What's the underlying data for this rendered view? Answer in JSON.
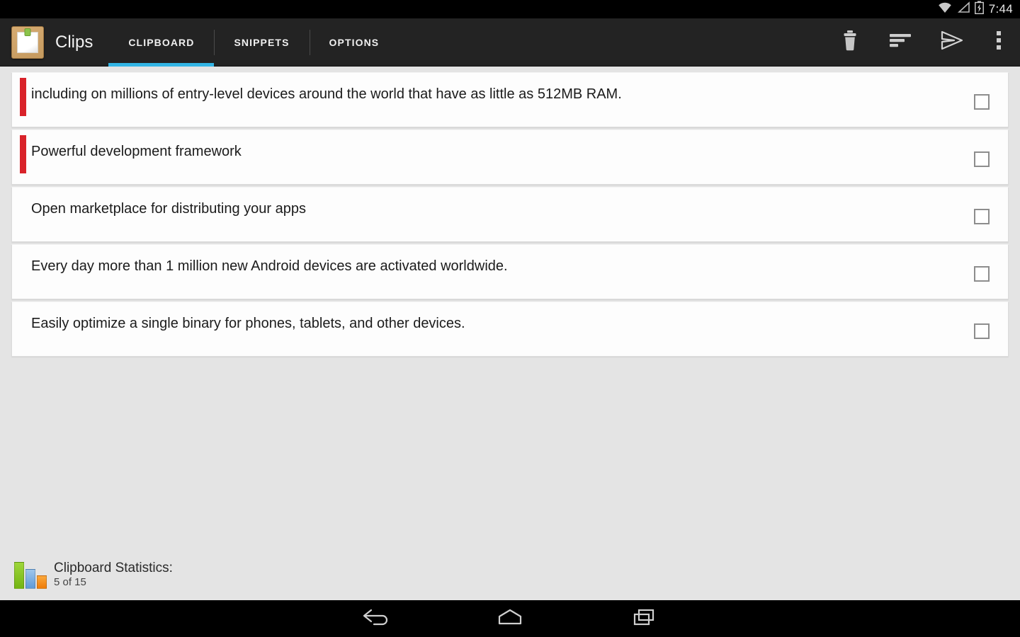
{
  "status_bar": {
    "time": "7:44",
    "icons": [
      "wifi-icon",
      "signal-icon",
      "battery-icon"
    ]
  },
  "action_bar": {
    "app_icon": "clipboard-app-icon",
    "title": "Clips",
    "accent_color": "#33b5e5",
    "background_color": "#232323",
    "tabs": [
      {
        "label": "CLIPBOARD",
        "active": true
      },
      {
        "label": "SNIPPETS",
        "active": false
      },
      {
        "label": "OPTIONS",
        "active": false
      }
    ],
    "actions": [
      {
        "name": "delete-button",
        "icon": "trash-icon"
      },
      {
        "name": "sort-button",
        "icon": "sort-icon"
      },
      {
        "name": "send-button",
        "icon": "send-icon"
      },
      {
        "name": "overflow-button",
        "icon": "more-vertical-icon"
      }
    ]
  },
  "clipboard_list": {
    "items": [
      {
        "text": "including on millions of entry-level devices around the world that have as little as 512MB RAM.",
        "marked": true,
        "checked": false
      },
      {
        "text": "Powerful development framework",
        "marked": true,
        "checked": false
      },
      {
        "text": "Open marketplace for distributing your apps",
        "marked": false,
        "checked": false
      },
      {
        "text": "Every day more than 1 million new Android devices are activated worldwide.",
        "marked": false,
        "checked": false
      },
      {
        "text": "Easily optimize a single binary for phones, tablets, and other devices.",
        "marked": false,
        "checked": false
      }
    ],
    "marker_color": "#d9232a"
  },
  "statistics": {
    "icon": "bar-chart-icon",
    "title": "Clipboard Statistics:",
    "count": "5 of 15",
    "bar_colors": [
      "#73b412",
      "#5e9ad8",
      "#ef7c08"
    ]
  },
  "nav_bar": {
    "buttons": [
      {
        "name": "back-button",
        "icon": "back-arrow-icon"
      },
      {
        "name": "home-button",
        "icon": "home-icon"
      },
      {
        "name": "recents-button",
        "icon": "recents-icon"
      }
    ]
  }
}
